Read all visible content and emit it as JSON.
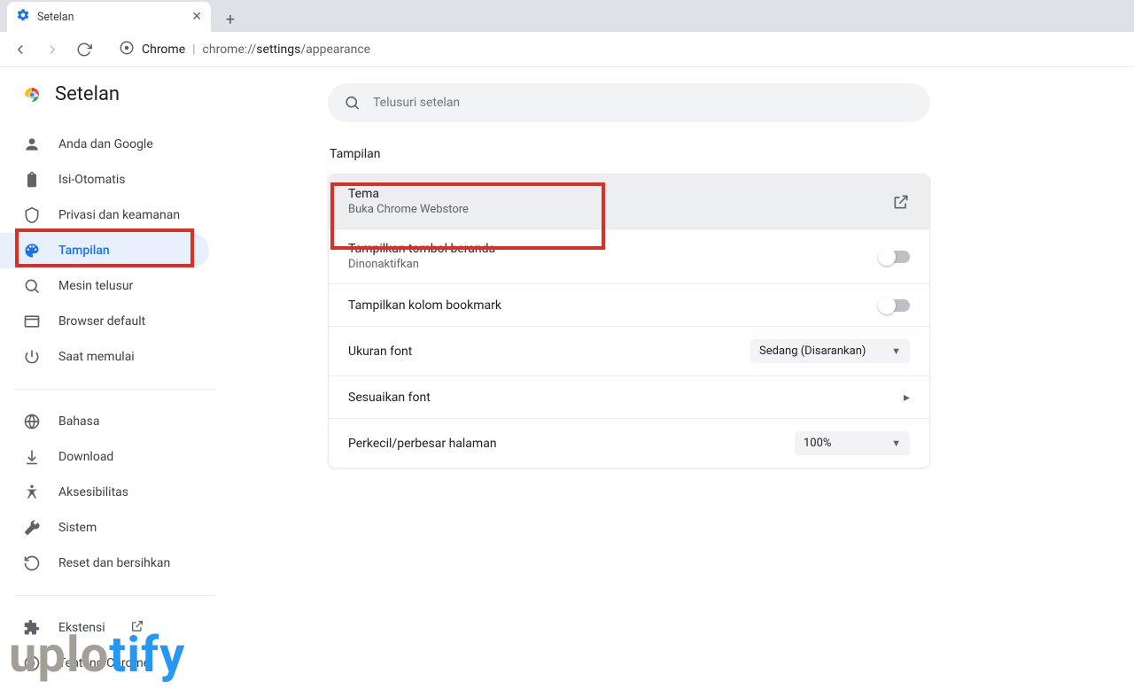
{
  "tab": {
    "title": "Setelan"
  },
  "omnibox": {
    "chrome_label": "Chrome",
    "url_prefix": "chrome://",
    "url_bold": "settings",
    "url_rest": "/appearance"
  },
  "app": {
    "title": "Setelan"
  },
  "search": {
    "placeholder": "Telusuri setelan"
  },
  "sidebar": {
    "items": [
      {
        "label": "Anda dan Google"
      },
      {
        "label": "Isi-Otomatis"
      },
      {
        "label": "Privasi dan keamanan"
      },
      {
        "label": "Tampilan"
      },
      {
        "label": "Mesin telusur"
      },
      {
        "label": "Browser default"
      },
      {
        "label": "Saat memulai"
      }
    ],
    "items2": [
      {
        "label": "Bahasa"
      },
      {
        "label": "Download"
      },
      {
        "label": "Aksesibilitas"
      },
      {
        "label": "Sistem"
      },
      {
        "label": "Reset dan bersihkan"
      }
    ],
    "items3": [
      {
        "label": "Ekstensi"
      },
      {
        "label": "Tentang Chrome"
      }
    ]
  },
  "section": {
    "title": "Tampilan"
  },
  "rows": {
    "theme": {
      "label": "Tema",
      "sub": "Buka Chrome Webstore"
    },
    "home": {
      "label": "Tampilkan tombol beranda",
      "sub": "Dinonaktifkan"
    },
    "bookmark": {
      "label": "Tampilkan kolom bookmark"
    },
    "fontsize": {
      "label": "Ukuran font",
      "value": "Sedang (Disarankan)"
    },
    "customfont": {
      "label": "Sesuaikan font"
    },
    "zoom": {
      "label": "Perkecil/perbesar halaman",
      "value": "100%"
    }
  },
  "watermark": {
    "part1": "uplo",
    "part2": "tify"
  }
}
